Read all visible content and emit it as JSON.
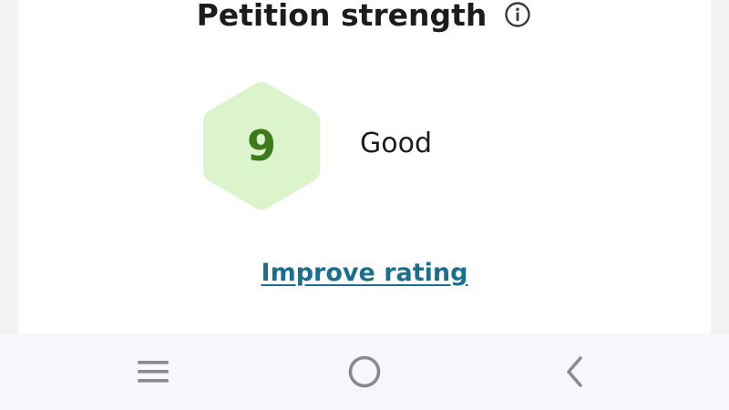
{
  "card": {
    "title": "Petition strength",
    "info_icon": "info-circle-icon",
    "score": "9",
    "rating_label": "Good",
    "improve_link": "Improve rating",
    "score_color": "#3d7a1c",
    "hex_color": "#dcf4cc",
    "link_color": "#1a6f8e"
  },
  "navbar": {
    "icons": [
      "menu-icon",
      "home-icon",
      "back-icon"
    ]
  }
}
